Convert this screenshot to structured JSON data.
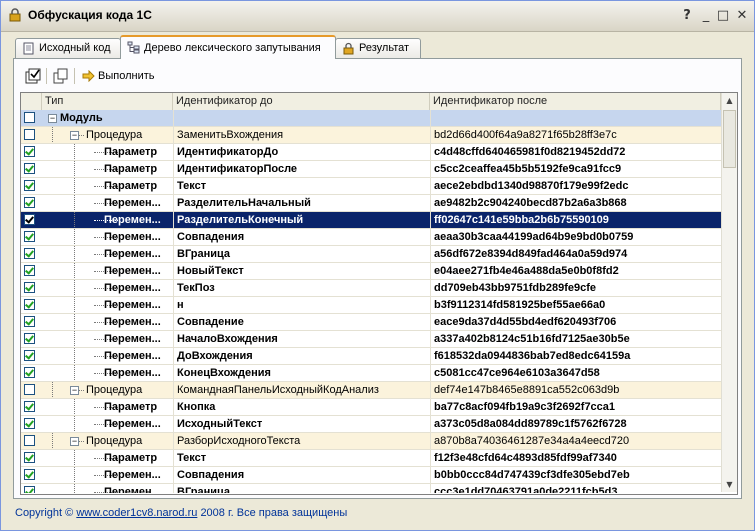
{
  "window": {
    "title": "Обфускация кода 1С"
  },
  "tabs": [
    {
      "label": "Исходный код"
    },
    {
      "label": "Дерево лексического запутывания"
    },
    {
      "label": "Результат"
    }
  ],
  "toolbar": {
    "run_label": "Выполнить"
  },
  "grid": {
    "headers": {
      "type": "Тип",
      "before": "Идентификатор до",
      "after": "Идентификатор после"
    },
    "rows": [
      {
        "kind": "module",
        "checked": false,
        "type": "Модуль",
        "before": "",
        "after": ""
      },
      {
        "kind": "proc",
        "checked": false,
        "type": "Процедура",
        "before": "ЗаменитьВхождения",
        "after": "bd2d66d400f64a9a8271f65b28ff3e7c"
      },
      {
        "kind": "item",
        "checked": true,
        "type": "Параметр",
        "before": "ИдентификаторДо",
        "after": "c4d48cffd640465981f0d8219452dd72"
      },
      {
        "kind": "item",
        "checked": true,
        "type": "Параметр",
        "before": "ИдентификаторПосле",
        "after": "c5cc2ceaffea45b5b5192fe9ca91fcc9"
      },
      {
        "kind": "item",
        "checked": true,
        "type": "Параметр",
        "before": "Текст",
        "after": "aece2ebdbd1340d98870f179e99f2edc"
      },
      {
        "kind": "item",
        "checked": true,
        "type": "Перемен...",
        "before": "РазделительНачальный",
        "after": "ae9482b2c904240becd87b2a6a3b868"
      },
      {
        "kind": "item",
        "checked": true,
        "type": "Перемен...",
        "before": "РазделительКонечный",
        "after": "ff02647c141e59bba2b6b75590109",
        "selected": true
      },
      {
        "kind": "item",
        "checked": true,
        "type": "Перемен...",
        "before": "Совпадения",
        "after": "aeaa30b3caa44199ad64b9e9bd0b0759"
      },
      {
        "kind": "item",
        "checked": true,
        "type": "Перемен...",
        "before": "ВГраница",
        "after": "a56df672e8394d849fad464a0a59d974"
      },
      {
        "kind": "item",
        "checked": true,
        "type": "Перемен...",
        "before": "НовыйТекст",
        "after": "e04aee271fb4e46a488da5e0b0f8fd2"
      },
      {
        "kind": "item",
        "checked": true,
        "type": "Перемен...",
        "before": "ТекПоз",
        "after": "dd709eb43bb9751fdb289fe9cfe"
      },
      {
        "kind": "item",
        "checked": true,
        "type": "Перемен...",
        "before": "н",
        "after": "b3f9112314fd581925bef55ae66a0"
      },
      {
        "kind": "item",
        "checked": true,
        "type": "Перемен...",
        "before": "Совпадение",
        "after": "eace9da37d4d55bd4edf620493f706"
      },
      {
        "kind": "item",
        "checked": true,
        "type": "Перемен...",
        "before": "НачалоВхождения",
        "after": "a337a402b8124c51b16fd7125ae30b5e"
      },
      {
        "kind": "item",
        "checked": true,
        "type": "Перемен...",
        "before": "ДоВхождения",
        "after": "f618532da0944836bab7ed8edc64159a"
      },
      {
        "kind": "item",
        "checked": true,
        "type": "Перемен...",
        "before": "КонецВхождения",
        "after": "c5081cc47ce964e6103a3647d58"
      },
      {
        "kind": "proc",
        "checked": false,
        "type": "Процедура",
        "before": "КоманднаяПанельИсходныйКодАнализ",
        "after": "def74e147b8465e8891ca552c063d9b"
      },
      {
        "kind": "item",
        "checked": true,
        "type": "Параметр",
        "before": "Кнопка",
        "after": "ba77c8acf094fb19a9c3f2692f7cca1"
      },
      {
        "kind": "item",
        "checked": true,
        "type": "Перемен...",
        "before": "ИсходныйТекст",
        "after": "a373c05d8a084dd89789c1f5762f6728"
      },
      {
        "kind": "proc",
        "checked": false,
        "type": "Процедура",
        "before": "РазборИсходногоТекста",
        "after": "a870b8a74036461287e34a4a4eecd720"
      },
      {
        "kind": "item",
        "checked": true,
        "type": "Параметр",
        "before": "Текст",
        "after": "f12f3e48cfd64c4893d85fdf99af7340"
      },
      {
        "kind": "item",
        "checked": true,
        "type": "Перемен...",
        "before": "Совпадения",
        "after": "b0bb0ccc84d747439cf3dfe305ebd7eb"
      },
      {
        "kind": "item",
        "checked": true,
        "type": "Перемен...",
        "before": "ВГраница",
        "after": "ccc3e1dd70463791a0de2211fcb5d3"
      }
    ]
  },
  "footer": {
    "copyright": "Copyright ©",
    "link": "www.coder1cv8.narod.ru",
    "rights": "2008 г. Все права защищены"
  }
}
